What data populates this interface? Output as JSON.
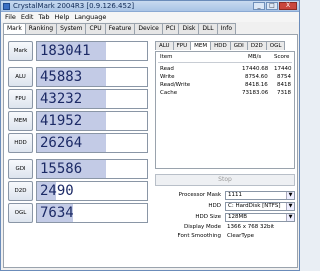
{
  "window": {
    "title": "CrystalMark 2004R3 [0.9.126.452]",
    "min": "_",
    "max": "□",
    "close": "X"
  },
  "menu": [
    "File",
    "Edit",
    "Tab",
    "Help",
    "Language"
  ],
  "tabs": [
    "Mark",
    "Ranking",
    "System",
    "CPU",
    "Feature",
    "Device",
    "PCI",
    "Disk",
    "DLL",
    "Info"
  ],
  "scores": [
    {
      "label": "Mark",
      "value": "183041",
      "fill": 0.63
    },
    {
      "label": "ALU",
      "value": "45883",
      "fill": 0.63
    },
    {
      "label": "FPU",
      "value": "43232",
      "fill": 0.63
    },
    {
      "label": "MEM",
      "value": "41952",
      "fill": 0.63
    },
    {
      "label": "HDD",
      "value": "26264",
      "fill": 0.63
    },
    {
      "label": "GDI",
      "value": "15586",
      "fill": 0.63
    },
    {
      "label": "D2D",
      "value": "2490",
      "fill": 0.17
    },
    {
      "label": "OGL",
      "value": "7634",
      "fill": 0.33
    }
  ],
  "subtabs": [
    "ALU",
    "FPU",
    "MEM",
    "HDD",
    "GDI",
    "D2D",
    "OGL"
  ],
  "mem_table": {
    "headers": {
      "item": "Item",
      "rate": "MB/s",
      "score": "Score"
    },
    "rows": [
      {
        "item": "Read",
        "rate": "17440.68",
        "score": "17440"
      },
      {
        "item": "Write",
        "rate": "8754.60",
        "score": "8754"
      },
      {
        "item": "Read/Write",
        "rate": "8418.16",
        "score": "8418"
      },
      {
        "item": "Cache",
        "rate": "73183.06",
        "score": "7318"
      }
    ]
  },
  "stop_label": "Stop",
  "settings": {
    "processor_mask_label": "Processor Mask",
    "processor_mask_value": "1111",
    "hdd_label": "HDD",
    "hdd_value": "C: HardDisk [NTFS]",
    "hdd_size_label": "HDD Size",
    "hdd_size_value": "128MB",
    "display_mode_label": "Display Mode",
    "display_mode_value": "1366 x 768 32bit",
    "font_smoothing_label": "Font Smoothing",
    "font_smoothing_value": "ClearType"
  }
}
